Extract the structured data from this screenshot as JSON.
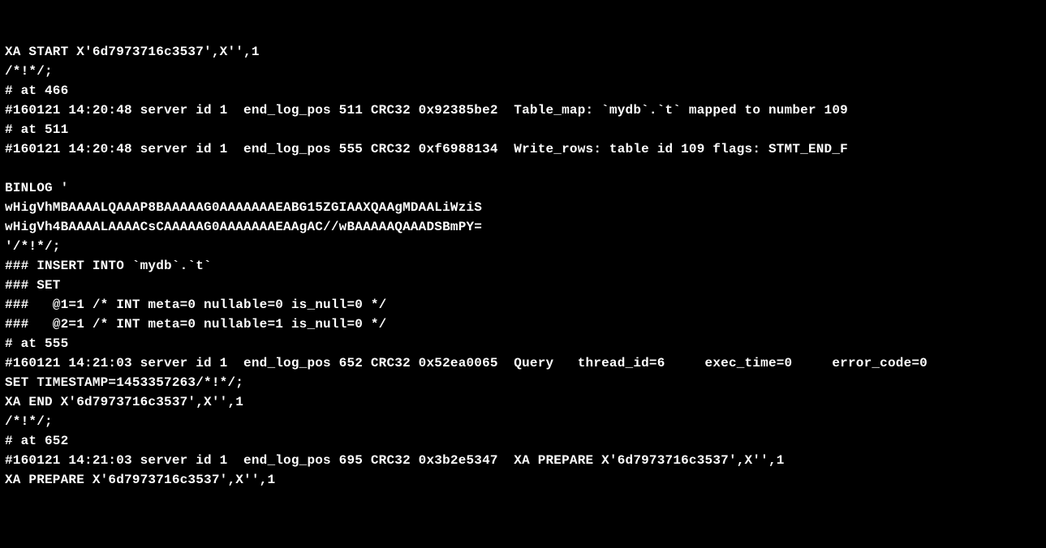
{
  "lines": [
    "XA START X'6d7973716c3537',X'',1",
    "/*!*/;",
    "# at 466",
    "#160121 14:20:48 server id 1  end_log_pos 511 CRC32 0x92385be2  Table_map: `mydb`.`t` mapped to number 109",
    "# at 511",
    "#160121 14:20:48 server id 1  end_log_pos 555 CRC32 0xf6988134  Write_rows: table id 109 flags: STMT_END_F",
    "",
    "BINLOG '",
    "wHigVhMBAAAALQAAAP8BAAAAAG0AAAAAAAEABG15ZGIAAXQAAgMDAALiWziS",
    "wHigVh4BAAAALAAAACsCAAAAAG0AAAAAAAEAAgAC//wBAAAAAQAAADSBmPY=",
    "'/*!*/;",
    "### INSERT INTO `mydb`.`t`",
    "### SET",
    "###   @1=1 /* INT meta=0 nullable=0 is_null=0 */",
    "###   @2=1 /* INT meta=0 nullable=1 is_null=0 */",
    "# at 555",
    "#160121 14:21:03 server id 1  end_log_pos 652 CRC32 0x52ea0065  Query   thread_id=6     exec_time=0     error_code=0",
    "SET TIMESTAMP=1453357263/*!*/;",
    "XA END X'6d7973716c3537',X'',1",
    "/*!*/;",
    "# at 652",
    "#160121 14:21:03 server id 1  end_log_pos 695 CRC32 0x3b2e5347  XA PREPARE X'6d7973716c3537',X'',1",
    "XA PREPARE X'6d7973716c3537',X'',1"
  ]
}
